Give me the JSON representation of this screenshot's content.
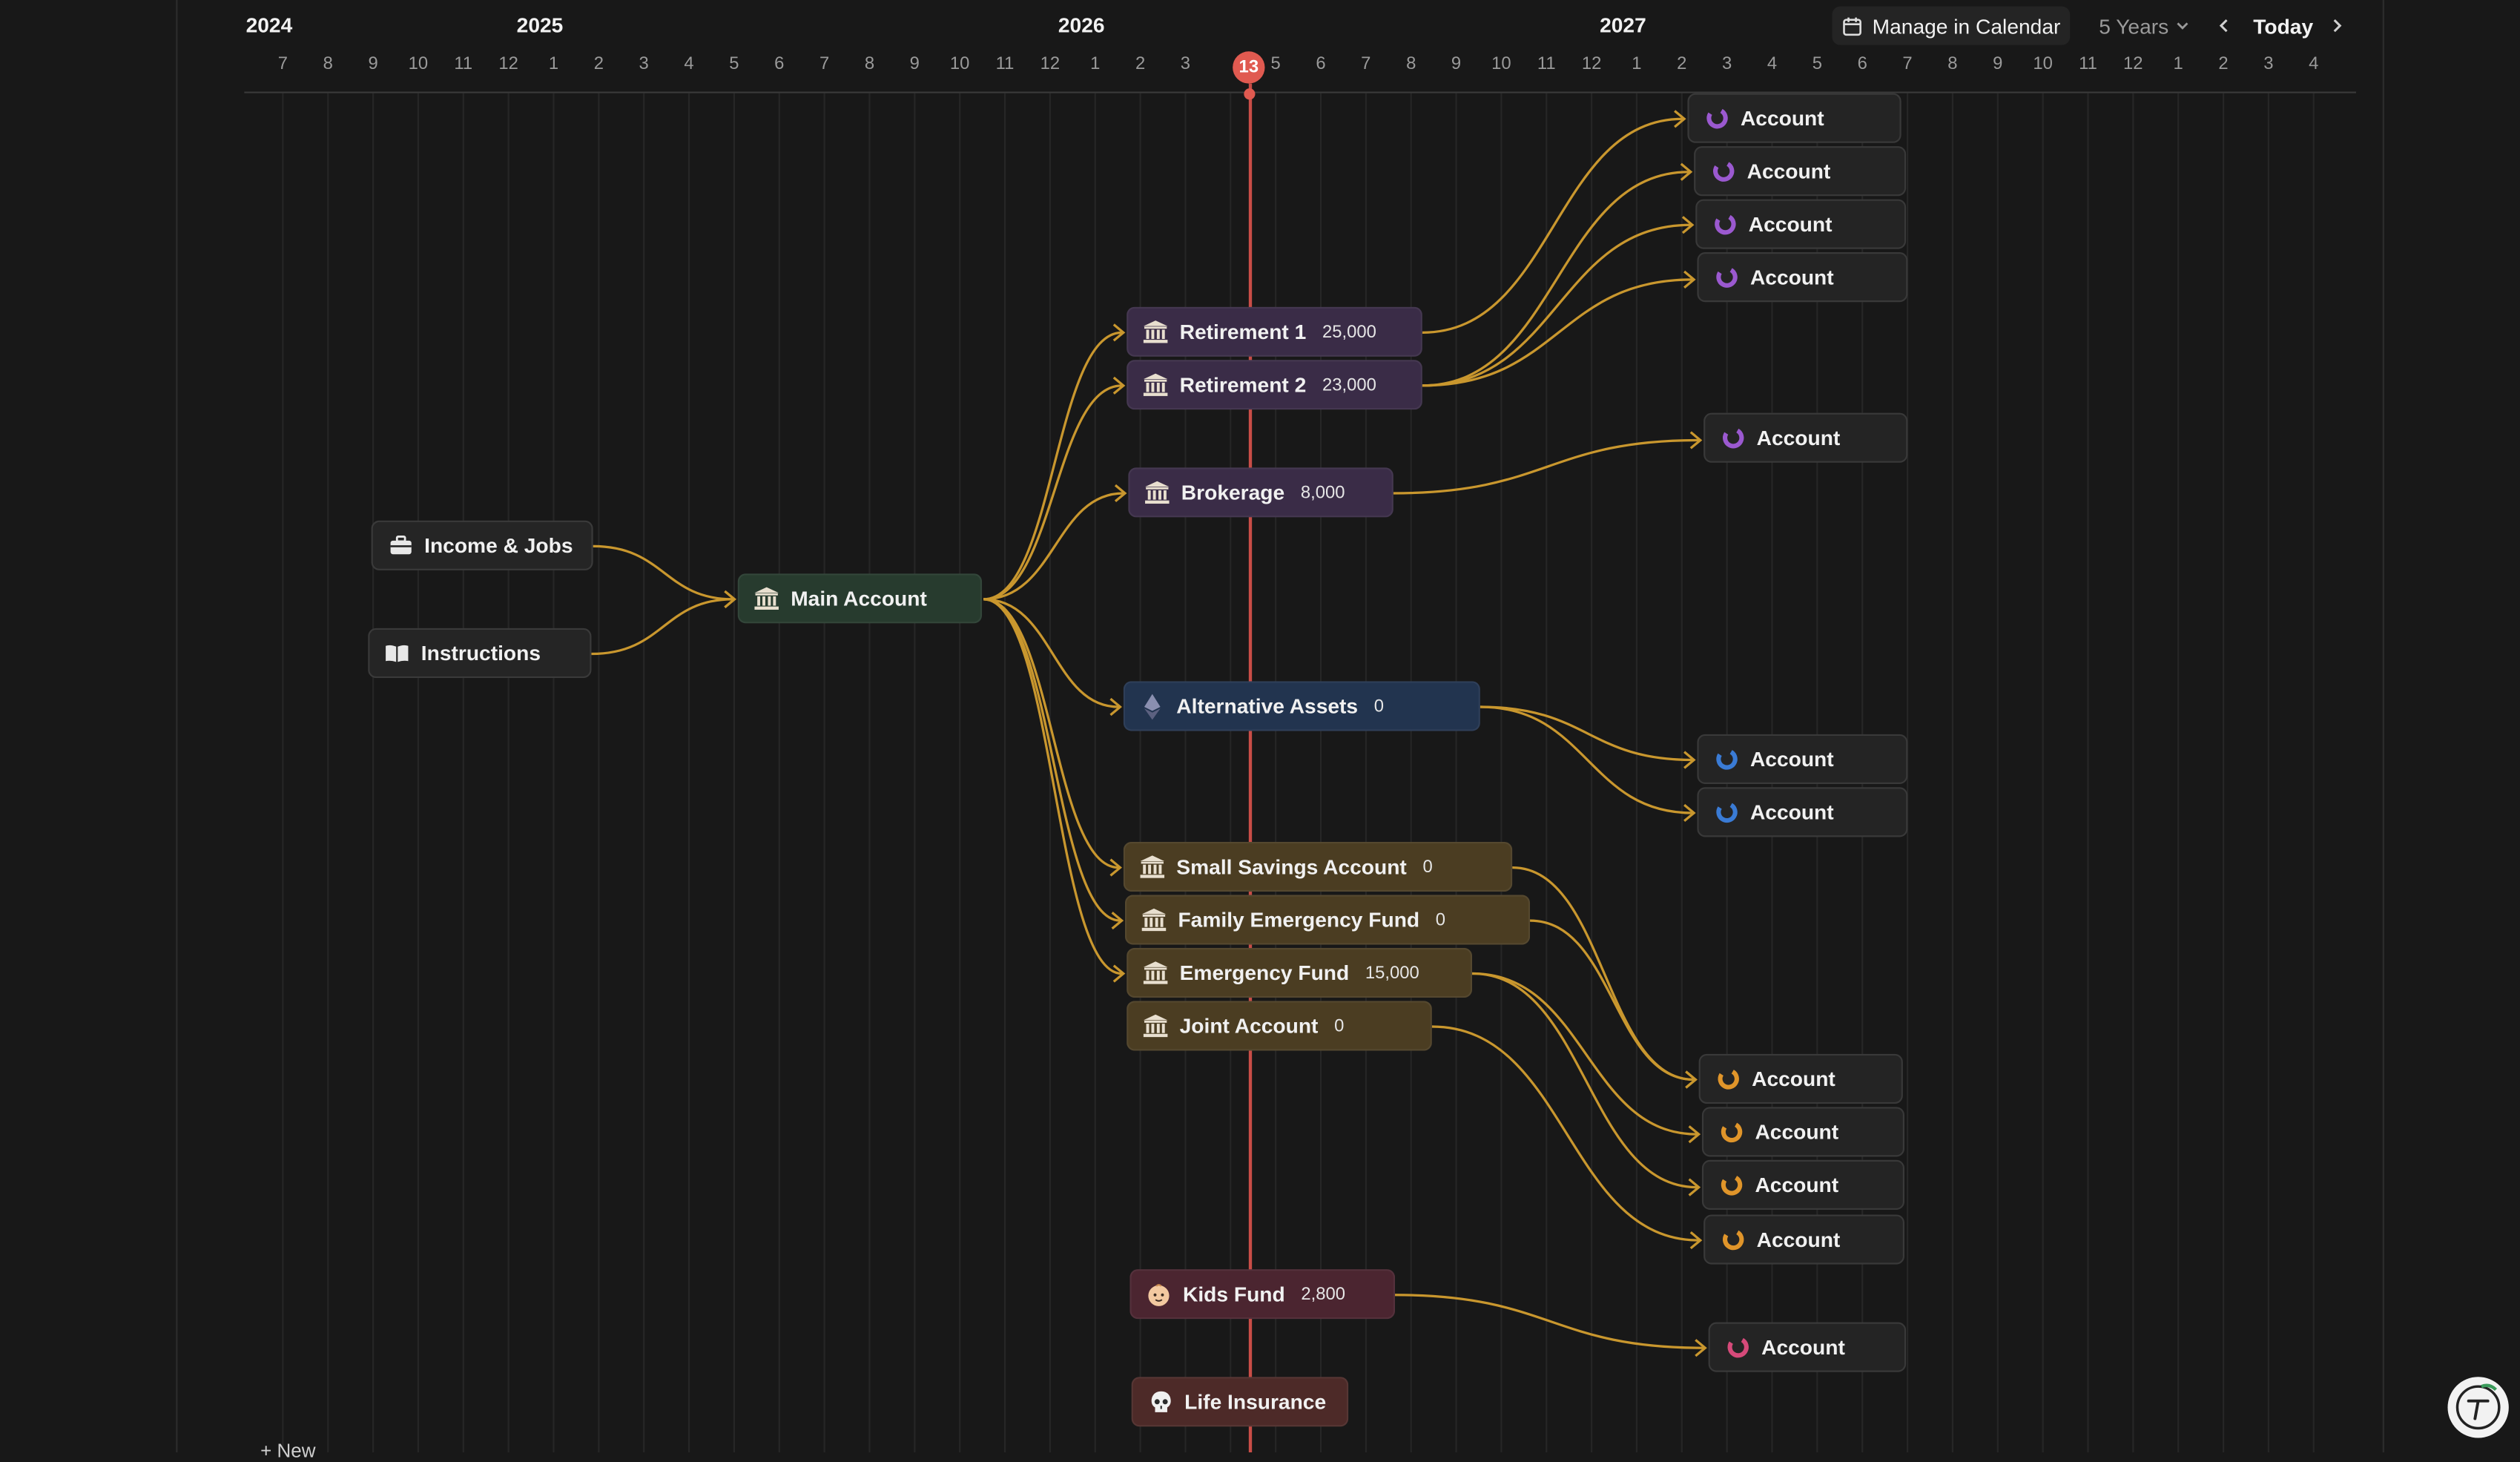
{
  "timeline": {
    "years": [
      {
        "label": "2024",
        "month_index": 0
      },
      {
        "label": "2025",
        "month_index": 6
      },
      {
        "label": "2026",
        "month_index": 18
      },
      {
        "label": "2027",
        "month_index": 30
      }
    ],
    "months": [
      "7",
      "8",
      "9",
      "10",
      "11",
      "12",
      "1",
      "2",
      "3",
      "4",
      "5",
      "6",
      "7",
      "8",
      "9",
      "10",
      "11",
      "12",
      "1",
      "2",
      "3",
      "4",
      "5",
      "6",
      "7",
      "8",
      "9",
      "10",
      "11",
      "12",
      "1",
      "2",
      "3",
      "4",
      "5",
      "6",
      "7",
      "8",
      "9",
      "10",
      "11",
      "12",
      "1",
      "2",
      "3",
      "4"
    ],
    "today_label": "13"
  },
  "toolbar": {
    "manage_label": "Manage in Calendar",
    "range_label": "5 Years",
    "today_label": "Today"
  },
  "nodes": {
    "income": {
      "label": "Income & Jobs"
    },
    "instructions": {
      "label": "Instructions"
    },
    "main": {
      "label": "Main Account"
    },
    "retirement1": {
      "label": "Retirement 1",
      "amount": "25,000"
    },
    "retirement2": {
      "label": "Retirement 2",
      "amount": "23,000"
    },
    "brokerage": {
      "label": "Brokerage",
      "amount": "8,000"
    },
    "alternative": {
      "label": "Alternative Assets",
      "amount": "0"
    },
    "small_savings": {
      "label": "Small Savings Account",
      "amount": "0"
    },
    "family_emergency": {
      "label": "Family Emergency Fund",
      "amount": "0"
    },
    "emergency": {
      "label": "Emergency Fund",
      "amount": "15,000"
    },
    "joint": {
      "label": "Joint Account",
      "amount": "0"
    },
    "kids": {
      "label": "Kids Fund",
      "amount": "2,800"
    },
    "life": {
      "label": "Life Insurance"
    }
  },
  "accounts": [
    {
      "label": "Account",
      "color": "#9b59d0"
    },
    {
      "label": "Account",
      "color": "#9b59d0"
    },
    {
      "label": "Account",
      "color": "#9b59d0"
    },
    {
      "label": "Account",
      "color": "#9b59d0"
    },
    {
      "label": "Account",
      "color": "#9b59d0"
    },
    {
      "label": "Account",
      "color": "#3a7bd5"
    },
    {
      "label": "Account",
      "color": "#3a7bd5"
    },
    {
      "label": "Account",
      "color": "#e0952a"
    },
    {
      "label": "Account",
      "color": "#e0952a"
    },
    {
      "label": "Account",
      "color": "#e0952a"
    },
    {
      "label": "Account",
      "color": "#e0952a"
    },
    {
      "label": "Account",
      "color": "#d64a7a"
    }
  ],
  "footer": {
    "new_label": "+ New"
  },
  "colors": {
    "link": "#c9972e",
    "today": "#e05a50"
  }
}
